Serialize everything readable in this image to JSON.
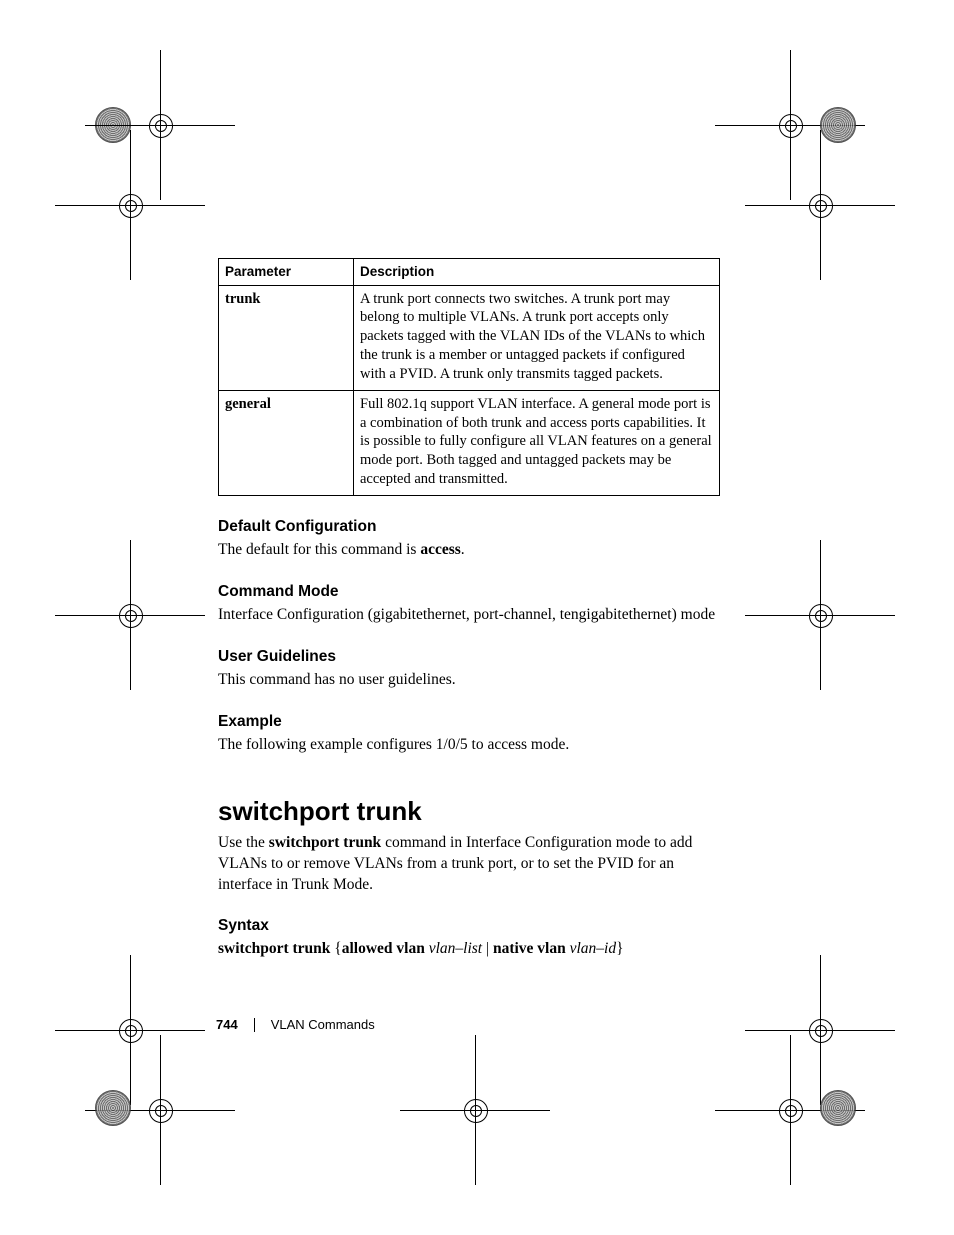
{
  "table": {
    "headers": [
      "Parameter",
      "Description"
    ],
    "rows": [
      {
        "param": "trunk",
        "desc": "A trunk port connects two switches.  A trunk port may belong to multiple VLANs.  A trunk port accepts only packets tagged with the VLAN IDs of the VLANs to which the trunk is a member or untagged packets if configured with a PVID.  A trunk only transmits tagged packets."
      },
      {
        "param": "general",
        "desc": "Full 802.1q support VLAN interface. A general mode port is a combination of both trunk and access ports capabilities. It is possible to fully configure all VLAN features on a general mode port. Both tagged and untagged packets may be accepted and transmitted."
      }
    ]
  },
  "sections": {
    "default_config": {
      "heading": "Default Configuration",
      "text_pre": "The default for this command is ",
      "text_bold": "access",
      "text_post": "."
    },
    "command_mode": {
      "heading": "Command Mode",
      "text": "Interface Configuration (gigabitethernet, port-channel, tengigabitethernet) mode"
    },
    "user_guidelines": {
      "heading": "User Guidelines",
      "text": "This command has no user guidelines."
    },
    "example": {
      "heading": "Example",
      "text": "The following example configures 1/0/5 to access mode."
    }
  },
  "command": {
    "title": "switchport trunk",
    "intro_pre": "Use the ",
    "intro_bold": "switchport trunk",
    "intro_post": " command in Interface Configuration mode to add VLANs to or remove VLANs from a trunk port, or to set the PVID for an interface in Trunk Mode.",
    "syntax_heading": "Syntax",
    "syntax": {
      "p1": "switchport trunk ",
      "brace_open": "{",
      "p2": "allowed vlan ",
      "arg1": "vlan–list",
      "sep": " | ",
      "p3": "native vlan ",
      "arg2": "vlan–id",
      "brace_close": "}"
    }
  },
  "footer": {
    "page": "744",
    "section": "VLAN Commands"
  }
}
